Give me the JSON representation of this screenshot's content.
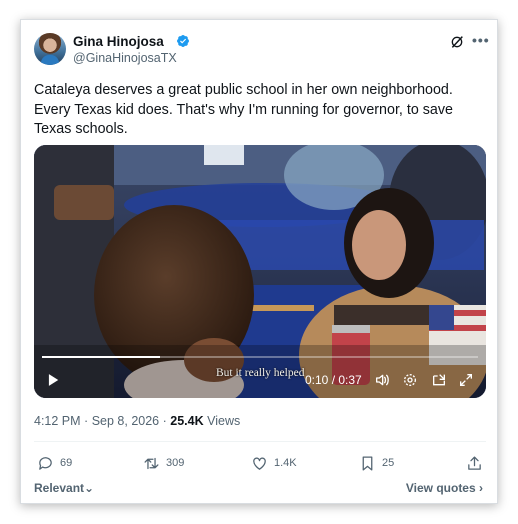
{
  "author": {
    "name": "Gina Hinojosa",
    "handle": "@GinaHinojosaTX"
  },
  "tweet": {
    "text": "Cataleya deserves a great public school in her own neighborhood. Every Texas kid does. That's why I'm running for governor, to save Texas schools."
  },
  "video": {
    "subtitle": "But it really helped",
    "time": "0:10 / 0:37",
    "progress": 0.27
  },
  "meta": {
    "time": "4:12 PM",
    "separator": "·",
    "date": "Sep 8, 2026",
    "separator2": "·",
    "views_count": "25.4K",
    "views_label": "Views"
  },
  "actions": {
    "replies": "69",
    "reposts": "309",
    "likes": "1.4K",
    "bookmarks": "25"
  },
  "footer": {
    "sort": "Relevant",
    "sort_chevron": "⌄",
    "view_quotes": "View quotes",
    "quotes_chevron": "›"
  },
  "colors": {
    "verified": "#1d9bf0",
    "text": "#0f1419",
    "muted": "#536471"
  }
}
